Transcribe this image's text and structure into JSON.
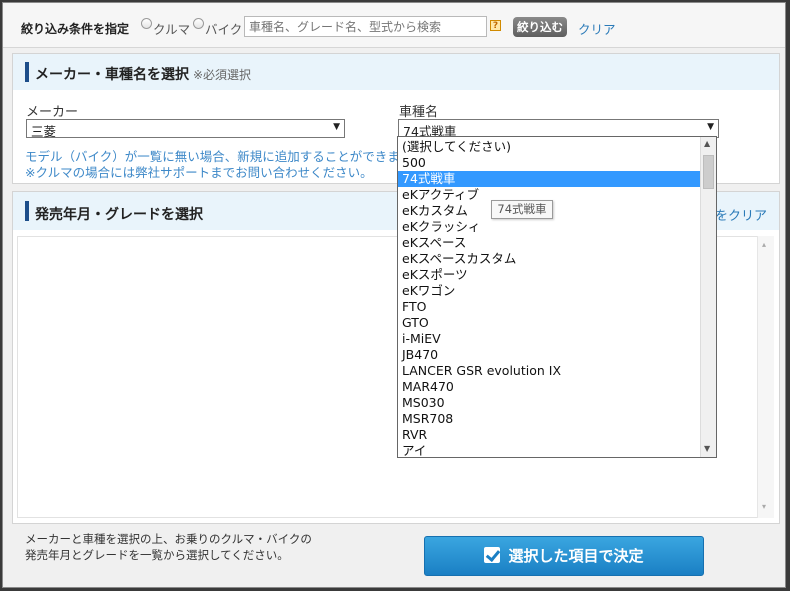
{
  "filter": {
    "label": "絞り込み条件を指定",
    "radio_car": "クルマ",
    "radio_bike": "バイク",
    "search_placeholder": "車種名、グレード名、型式から検索",
    "help_glyph": "?",
    "narrow_button": "絞り込む",
    "clear_link": "クリア"
  },
  "maker_section": {
    "title": "メーカー・車種名を選択",
    "note": "※必須選択",
    "maker_label": "メーカー",
    "maker_value": "三菱",
    "model_label": "車種名",
    "model_value": "74式戦車",
    "notice_line1": "モデル（バイク）が一覧に無い場合、新規に追加することができます。",
    "notice_line2": "※クルマの場合には弊社サポートまでお問い合わせください。"
  },
  "grade_section": {
    "title": "発売年月・グレードを選択",
    "clear_selection_link": "をクリア"
  },
  "footer": {
    "line1": "メーカーと車種を選択の上、お乗りのクルマ・バイクの",
    "line2": "発売年月とグレードを一覧から選択してください。",
    "decide_button": "選択した項目で決定"
  },
  "dropdown": {
    "options": [
      "(選択してください)",
      "500",
      "74式戦車",
      "eKアクティブ",
      "eKカスタム",
      "eKクラッシィ",
      "eKスペース",
      "eKスペースカスタム",
      "eKスポーツ",
      "eKワゴン",
      "FTO",
      "GTO",
      "i-MiEV",
      "JB470",
      "LANCER GSR evolution IX",
      "MAR470",
      "MS030",
      "MSR708",
      "RVR",
      "アイ"
    ],
    "selected_index": 2,
    "tooltip": "74式戦車"
  },
  "icons": {
    "arrow_down": "▼",
    "arrow_up": "▲",
    "small_down": "▾",
    "small_up": "▴"
  }
}
